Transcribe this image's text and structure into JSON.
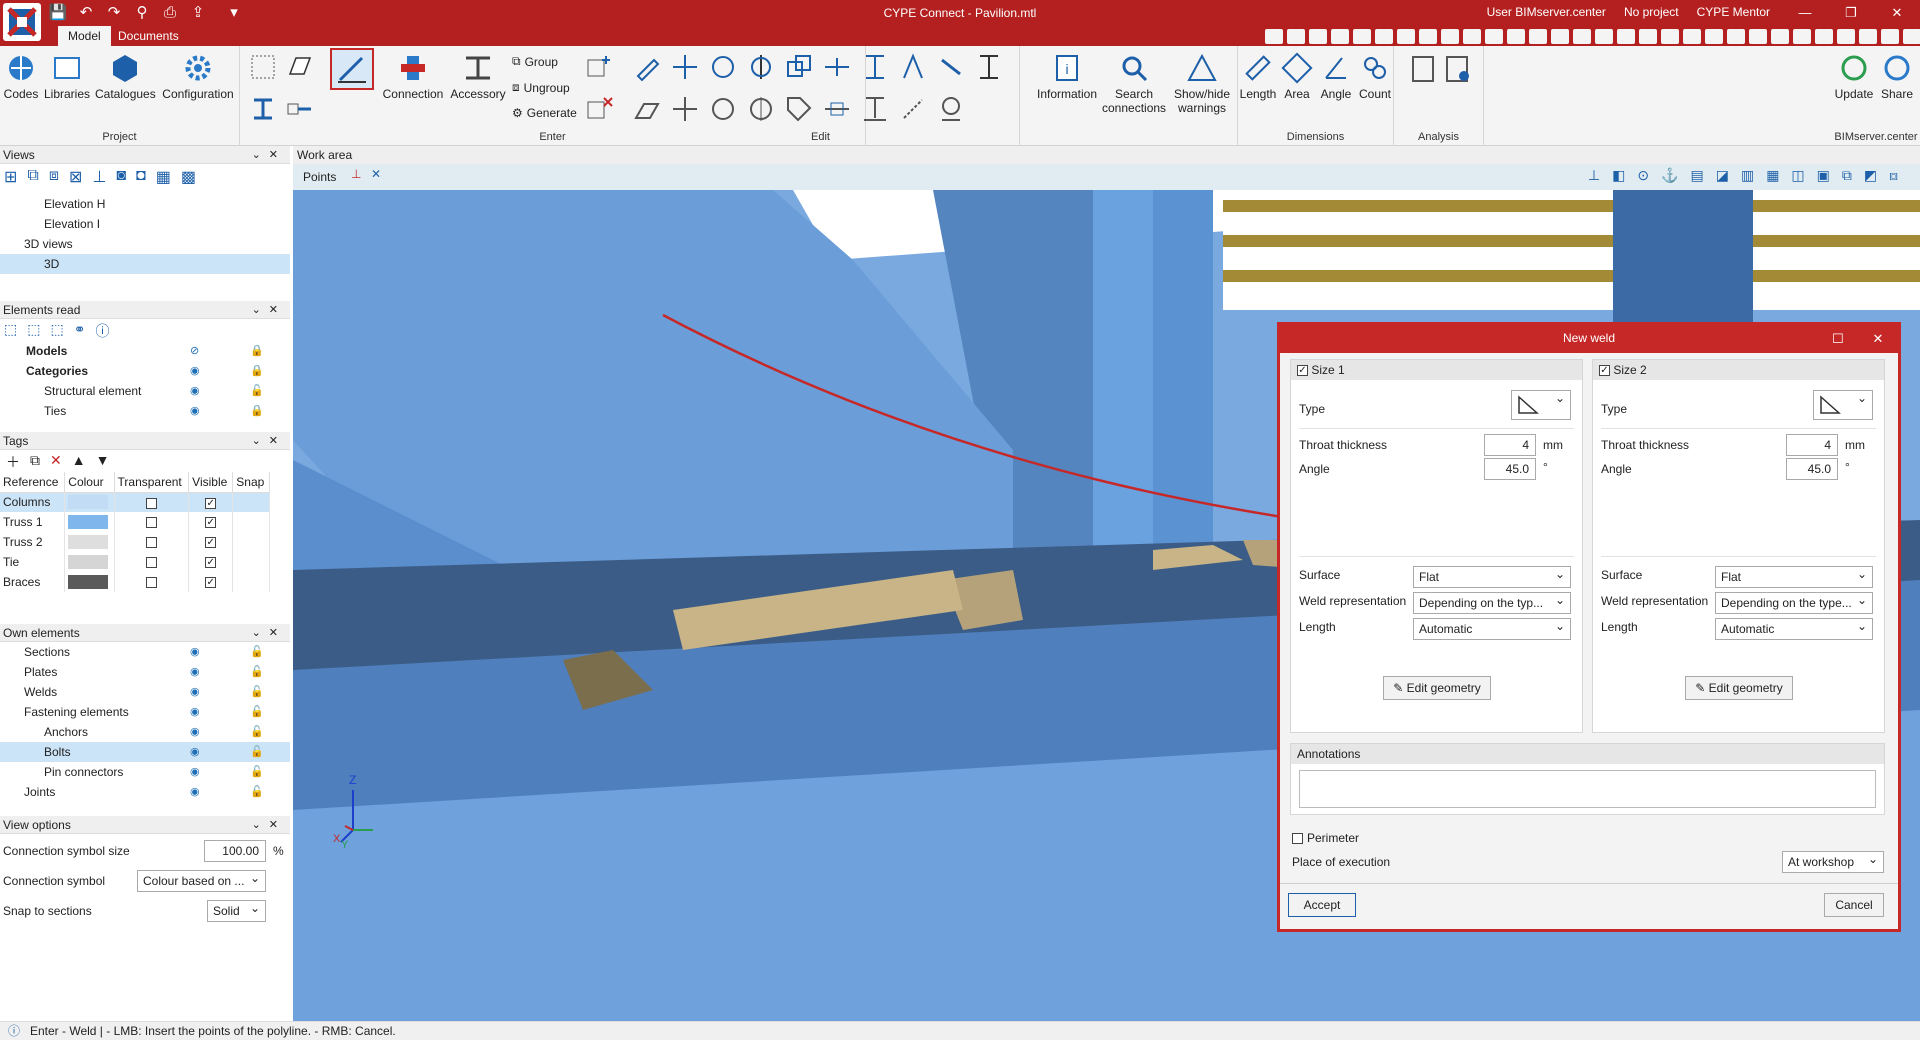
{
  "app": {
    "title": "CYPE Connect - Pavilion.mtl",
    "user": "User BIMserver.center",
    "project": "No project",
    "mentor": "CYPE Mentor"
  },
  "tabs": [
    "Model",
    "Documents"
  ],
  "ribbon": {
    "project": {
      "label": "Project",
      "codes": "Codes",
      "libraries": "Libraries",
      "catalogues": "Catalogues",
      "configuration": "Configuration"
    },
    "enter": {
      "label": "Enter",
      "connection": "Connection",
      "accessory": "Accessory",
      "group": "Group",
      "ungroup": "Ungroup",
      "generate": "Generate"
    },
    "edit": {
      "label": "Edit"
    },
    "info": {
      "information": "Information",
      "search": "Search connections",
      "showhide": "Show/hide warnings"
    },
    "dimensions": {
      "label": "Dimensions",
      "length": "Length",
      "area": "Area",
      "angle": "Angle",
      "count": "Count"
    },
    "analysis": {
      "label": "Analysis"
    },
    "bim": {
      "label": "BIMserver.center",
      "update": "Update",
      "share": "Share"
    }
  },
  "views": {
    "title": "Views",
    "items": [
      "Elevation H",
      "Elevation I",
      "3D views",
      "3D"
    ]
  },
  "elements_read": {
    "title": "Elements read",
    "items": [
      "Models",
      "Categories",
      "Structural element",
      "Ties"
    ]
  },
  "tags": {
    "title": "Tags",
    "columns": [
      "Reference",
      "Colour",
      "Transparent",
      "Visible",
      "Snap"
    ],
    "rows": [
      {
        "ref": "Columns",
        "color": "#c2dcf6",
        "transparent": false,
        "visible": true
      },
      {
        "ref": "Truss 1",
        "color": "#7fb7ec",
        "transparent": false,
        "visible": true
      },
      {
        "ref": "Truss 2",
        "color": "#dedede",
        "transparent": false,
        "visible": true
      },
      {
        "ref": "Tie",
        "color": "#d5d5d5",
        "transparent": false,
        "visible": true
      },
      {
        "ref": "Braces",
        "color": "#5a5a5a",
        "transparent": false,
        "visible": true
      }
    ]
  },
  "own_elements": {
    "title": "Own elements",
    "items": [
      "Sections",
      "Plates",
      "Welds",
      "Fastening elements",
      "Anchors",
      "Bolts",
      "Pin connectors",
      "Joints"
    ]
  },
  "view_options": {
    "title": "View options",
    "symbol_size_label": "Connection symbol size",
    "symbol_size": "100.00",
    "percent": "%",
    "symbol_label": "Connection symbol",
    "symbol": "Colour based on ...",
    "snap_label": "Snap to sections",
    "snap": "Solid"
  },
  "workarea": {
    "title": "Work area",
    "points": "Points"
  },
  "dialog": {
    "title": "New weld",
    "size1": {
      "header": "Size 1",
      "type": "Type",
      "throat_label": "Throat thickness",
      "throat": "4",
      "unit": "mm",
      "angle_label": "Angle",
      "angle": "45.0",
      "deg": "°",
      "surface_label": "Surface",
      "surface": "Flat",
      "rep_label": "Weld representation",
      "rep": "Depending on the typ...",
      "length_label": "Length",
      "length": "Automatic",
      "edit": "Edit geometry"
    },
    "size2": {
      "header": "Size 2",
      "type": "Type",
      "throat_label": "Throat thickness",
      "throat": "4",
      "unit": "mm",
      "angle_label": "Angle",
      "angle": "45.0",
      "deg": "°",
      "surface_label": "Surface",
      "surface": "Flat",
      "rep_label": "Weld representation",
      "rep": "Depending on the type...",
      "length_label": "Length",
      "length": "Automatic",
      "edit": "Edit geometry"
    },
    "annotations": "Annotations",
    "perimeter": "Perimeter",
    "place_label": "Place of execution",
    "place": "At workshop",
    "accept": "Accept",
    "cancel": "Cancel"
  },
  "status": "Enter - Weld  |  - LMB: Insert the points of the polyline. - RMB: Cancel.",
  "axes": {
    "z": "Z",
    "x": "X",
    "y": "Y"
  }
}
